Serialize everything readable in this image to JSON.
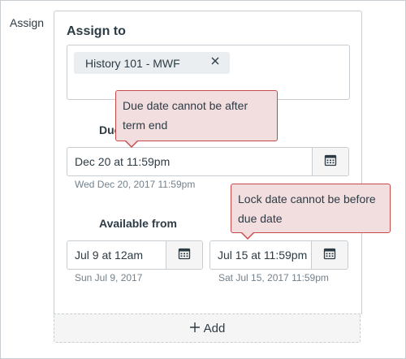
{
  "assign_label": "Assign",
  "section_title": "Assign to",
  "assignees": [
    {
      "label": "History 101 - MWF",
      "remove_icon": "close-icon"
    }
  ],
  "due": {
    "label": "Due",
    "value": "Dec 20 at 11:59pm",
    "hint": "Wed Dec 20, 2017 11:59pm",
    "error": "Due date cannot be after term end",
    "icon": "calendar-icon"
  },
  "available_from": {
    "label": "Available from",
    "value": "Jul 9 at 12am",
    "hint": "Sun Jul 9, 2017",
    "icon": "calendar-icon"
  },
  "until": {
    "value": "Jul 15 at 11:59pm",
    "hint": "Sat Jul 15, 2017 11:59pm",
    "error": "Lock date cannot be before due date",
    "icon": "calendar-icon"
  },
  "add_button": {
    "label": "Add",
    "icon": "plus-icon"
  },
  "colors": {
    "error_bg": "#f2dede",
    "error_border": "#c74949",
    "text": "#2d3b45",
    "hint": "#73818c",
    "border": "#c7cdd1"
  }
}
